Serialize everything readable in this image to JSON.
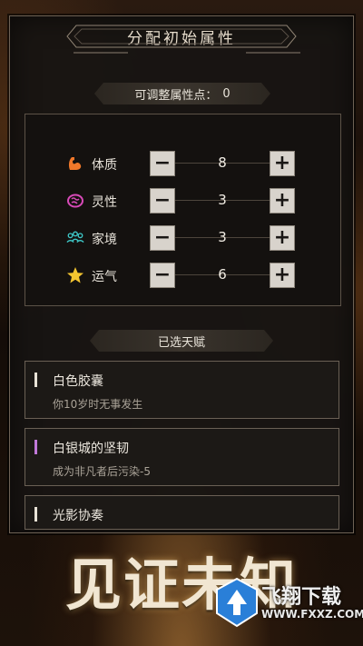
{
  "panel": {
    "title": "分配初始属性",
    "points_label": "可调整属性点：",
    "points_value": "0"
  },
  "attributes": [
    {
      "icon": "muscle-icon",
      "label": "体质",
      "value": "8",
      "minus": "−",
      "plus": "+"
    },
    {
      "icon": "brain-icon",
      "label": "灵性",
      "value": "3",
      "minus": "−",
      "plus": "+"
    },
    {
      "icon": "family-icon",
      "label": "家境",
      "value": "3",
      "minus": "−",
      "plus": "+"
    },
    {
      "icon": "star-icon",
      "label": "运气",
      "value": "6",
      "minus": "−",
      "plus": "+"
    }
  ],
  "talents_header": "已选天赋",
  "talents": [
    {
      "name": "白色胶囊",
      "desc": "你10岁时无事发生",
      "marker_color": "#e8e2d6"
    },
    {
      "name": "白银城的坚韧",
      "desc": "成为非凡者后污染-5",
      "marker_color": "#c078d8"
    },
    {
      "name": "光影协奏",
      "desc": "",
      "marker_color": "#e8e2d6"
    }
  ],
  "bottom_title": "见证未知",
  "watermark": {
    "title": "飞翔下载",
    "url": "WWW.FXXZ.COM"
  },
  "colors": {
    "muscle": "#f0782a",
    "brain": "#d84ab8",
    "family": "#3ec8c8",
    "star": "#f5c630"
  }
}
